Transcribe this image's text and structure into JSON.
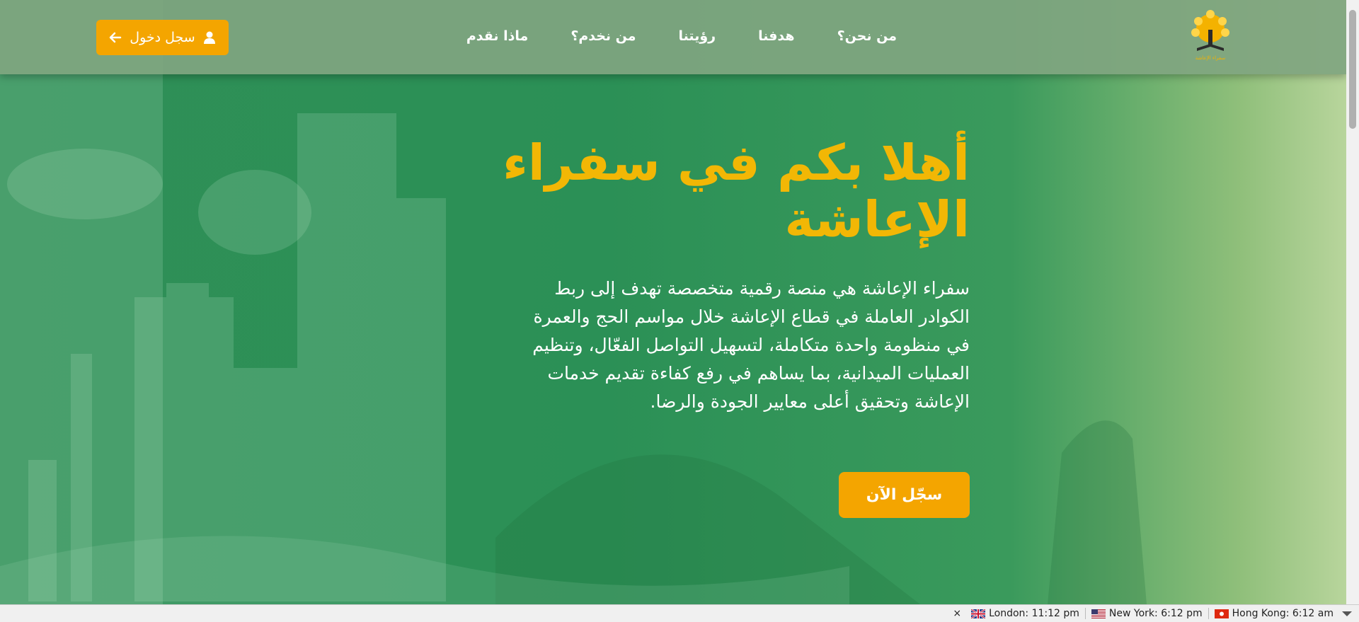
{
  "nav": {
    "items": [
      "من نحن؟",
      "هدفنا",
      "رؤيتنا",
      "من نخدم؟",
      "ماذا نقدم"
    ],
    "login_label": "سجل دخول"
  },
  "logo": {
    "text": "سفراء الإعاشة"
  },
  "hero": {
    "title": "أهلا بكم في سفراء الإعاشة",
    "description": "سفراء الإعاشة هي منصة رقمية متخصصة تهدف إلى ربط الكوادر العاملة في قطاع الإعاشة خلال مواسم الحج والعمرة في منظومة واحدة متكاملة، لتسهيل التواصل الفعّال، وتنظيم العمليات الميدانية، بما يساهم في رفع كفاءة تقديم خدمات الإعاشة وتحقيق أعلى معايير الجودة والرضا.",
    "cta_label": "سجّل الآن"
  },
  "clocks": [
    {
      "label": "London: 11:12 pm",
      "flag": "uk-flag"
    },
    {
      "label": "New York: 6:12 pm",
      "flag": "us-flag"
    },
    {
      "label": "Hong Kong: 6:12 am",
      "flag": "hk-flag"
    }
  ],
  "colors": {
    "accent": "#f4a500",
    "title": "#f2b705",
    "hero_bg": "#2e8f56",
    "nav_bg": "#80a580"
  }
}
